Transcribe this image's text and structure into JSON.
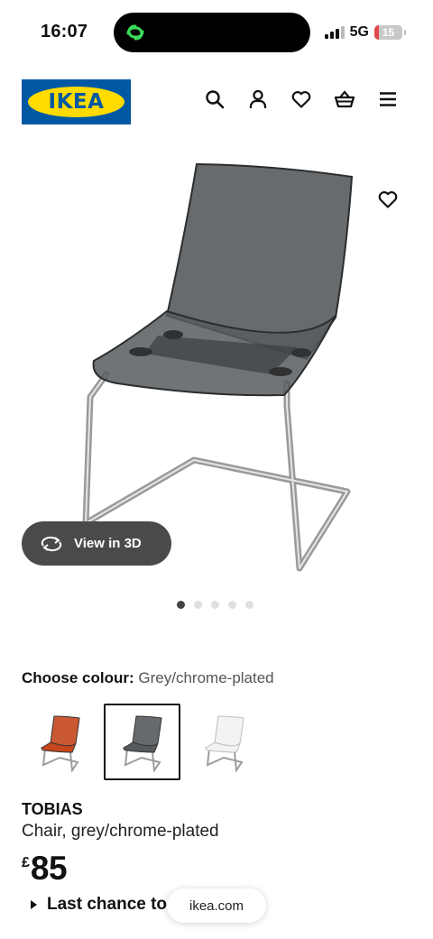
{
  "status_bar": {
    "time": "16:07",
    "network": "5G",
    "battery": "15",
    "battery_level": 0.15
  },
  "header": {
    "logo_text": "IKEA",
    "icons": [
      "search-icon",
      "user-icon",
      "heart-icon",
      "basket-icon",
      "menu-icon"
    ]
  },
  "gallery": {
    "view3d_label": "View in 3D",
    "dot_count": 5,
    "active_dot": 0
  },
  "colour": {
    "label": "Choose colour:",
    "value": "Grey/chrome-plated",
    "swatches": [
      {
        "name": "orange",
        "color": "#c4461d",
        "selected": false
      },
      {
        "name": "grey",
        "color": "#555a5e",
        "selected": true
      },
      {
        "name": "white",
        "color": "#f2f2f2",
        "selected": false
      }
    ]
  },
  "product": {
    "name": "TOBIAS",
    "description": "Chair, grey/chrome-plated",
    "currency": "£",
    "price": "85",
    "last_chance": "Last chance to"
  },
  "browser": {
    "url": "ikea.com"
  },
  "colors": {
    "ikea_blue": "#0058a3",
    "ikea_yellow": "#ffdb00"
  }
}
